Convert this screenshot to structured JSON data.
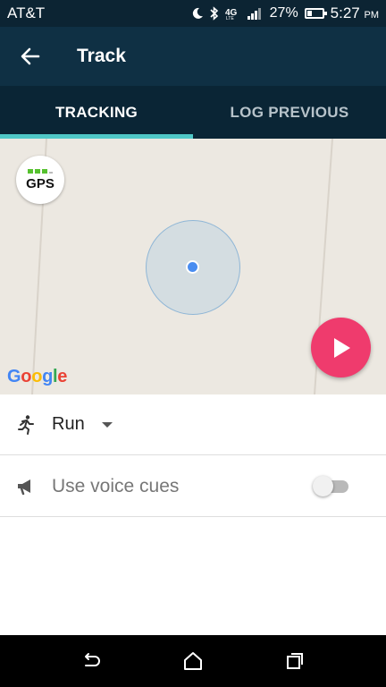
{
  "status_bar": {
    "carrier": "AT&T",
    "battery_percent": "27%",
    "battery_level": 0.27,
    "time": "5:27",
    "time_suffix": "PM",
    "icons": [
      "moon-icon",
      "bluetooth-icon",
      "4g-lte-icon",
      "signal-icon",
      "battery-icon"
    ]
  },
  "app_bar": {
    "title": "Track",
    "back_icon": "arrow-left-icon"
  },
  "tabs": [
    {
      "label": "TRACKING",
      "active": true
    },
    {
      "label": "LOG PREVIOUS",
      "active": false
    }
  ],
  "map": {
    "gps_badge": "GPS",
    "gps_signal_bars": 3,
    "attribution": "Google",
    "play_icon": "play-icon",
    "colors": {
      "accuracy_fill": "#aac8e1",
      "location_dot": "#4a8df0",
      "play_button": "#ef3b6d"
    }
  },
  "activity": {
    "label": "Run",
    "icon": "running-person-icon"
  },
  "voice_cues": {
    "label": "Use voice cues",
    "icon": "megaphone-icon",
    "enabled": false
  },
  "nav_bar": {
    "icons": [
      "back-nav-icon",
      "home-nav-icon",
      "recents-nav-icon"
    ]
  },
  "colors": {
    "app_bar": "#0f3044",
    "tab_bar": "#0a2535",
    "tab_indicator": "#4fc7c6",
    "accent": "#ef3b6d"
  }
}
